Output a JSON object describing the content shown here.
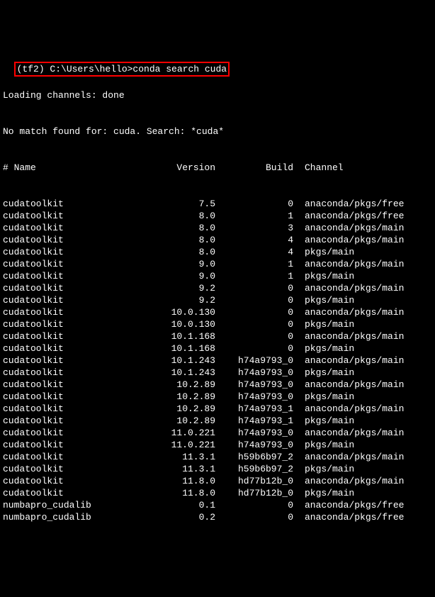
{
  "prompt": "(tf2) C:\\Users\\hello>conda search cuda",
  "line1": "Loading channels: done",
  "line2": "No match found for: cuda. Search: *cuda*",
  "header": {
    "name": "# Name",
    "version": "Version",
    "build": "Build",
    "channel": "Channel"
  },
  "rows": [
    {
      "name": "cudatoolkit",
      "version": "7.5",
      "build": "0",
      "channel": "anaconda/pkgs/free"
    },
    {
      "name": "cudatoolkit",
      "version": "8.0",
      "build": "1",
      "channel": "anaconda/pkgs/free"
    },
    {
      "name": "cudatoolkit",
      "version": "8.0",
      "build": "3",
      "channel": "anaconda/pkgs/main"
    },
    {
      "name": "cudatoolkit",
      "version": "8.0",
      "build": "4",
      "channel": "anaconda/pkgs/main"
    },
    {
      "name": "cudatoolkit",
      "version": "8.0",
      "build": "4",
      "channel": "pkgs/main"
    },
    {
      "name": "cudatoolkit",
      "version": "9.0",
      "build": "1",
      "channel": "anaconda/pkgs/main"
    },
    {
      "name": "cudatoolkit",
      "version": "9.0",
      "build": "1",
      "channel": "pkgs/main"
    },
    {
      "name": "cudatoolkit",
      "version": "9.2",
      "build": "0",
      "channel": "anaconda/pkgs/main"
    },
    {
      "name": "cudatoolkit",
      "version": "9.2",
      "build": "0",
      "channel": "pkgs/main"
    },
    {
      "name": "cudatoolkit",
      "version": "10.0.130",
      "build": "0",
      "channel": "anaconda/pkgs/main"
    },
    {
      "name": "cudatoolkit",
      "version": "10.0.130",
      "build": "0",
      "channel": "pkgs/main"
    },
    {
      "name": "cudatoolkit",
      "version": "10.1.168",
      "build": "0",
      "channel": "anaconda/pkgs/main"
    },
    {
      "name": "cudatoolkit",
      "version": "10.1.168",
      "build": "0",
      "channel": "pkgs/main"
    },
    {
      "name": "cudatoolkit",
      "version": "10.1.243",
      "build": "h74a9793_0",
      "channel": "anaconda/pkgs/main"
    },
    {
      "name": "cudatoolkit",
      "version": "10.1.243",
      "build": "h74a9793_0",
      "channel": "pkgs/main"
    },
    {
      "name": "cudatoolkit",
      "version": "10.2.89",
      "build": "h74a9793_0",
      "channel": "anaconda/pkgs/main"
    },
    {
      "name": "cudatoolkit",
      "version": "10.2.89",
      "build": "h74a9793_0",
      "channel": "pkgs/main"
    },
    {
      "name": "cudatoolkit",
      "version": "10.2.89",
      "build": "h74a9793_1",
      "channel": "anaconda/pkgs/main"
    },
    {
      "name": "cudatoolkit",
      "version": "10.2.89",
      "build": "h74a9793_1",
      "channel": "pkgs/main"
    },
    {
      "name": "cudatoolkit",
      "version": "11.0.221",
      "build": "h74a9793_0",
      "channel": "anaconda/pkgs/main"
    },
    {
      "name": "cudatoolkit",
      "version": "11.0.221",
      "build": "h74a9793_0",
      "channel": "pkgs/main"
    },
    {
      "name": "cudatoolkit",
      "version": "11.3.1",
      "build": "h59b6b97_2",
      "channel": "anaconda/pkgs/main"
    },
    {
      "name": "cudatoolkit",
      "version": "11.3.1",
      "build": "h59b6b97_2",
      "channel": "pkgs/main"
    },
    {
      "name": "cudatoolkit",
      "version": "11.8.0",
      "build": "hd77b12b_0",
      "channel": "anaconda/pkgs/main"
    },
    {
      "name": "cudatoolkit",
      "version": "11.8.0",
      "build": "hd77b12b_0",
      "channel": "pkgs/main"
    },
    {
      "name": "numbapro_cudalib",
      "version": "0.1",
      "build": "0",
      "channel": "anaconda/pkgs/free"
    },
    {
      "name": "numbapro_cudalib",
      "version": "0.2",
      "build": "0",
      "channel": "anaconda/pkgs/free"
    }
  ]
}
